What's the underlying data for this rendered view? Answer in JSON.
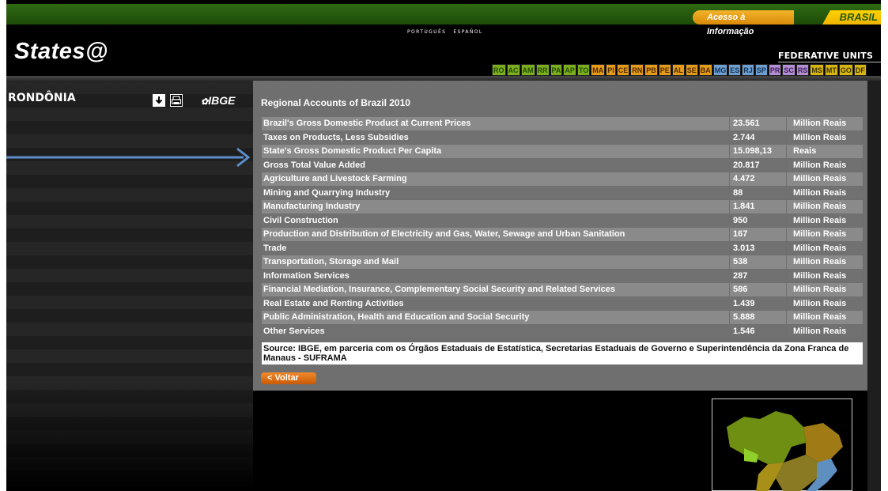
{
  "gov_bar": {
    "acesso": "Acesso à Informação",
    "brasil": "BRASIL"
  },
  "header": {
    "languages": [
      "PORTUGUÊS",
      "ESPAÑOL"
    ],
    "logo": "States@",
    "federative_units": "FEDERATIVE UNITS",
    "states": [
      {
        "code": "RO",
        "color": "g"
      },
      {
        "code": "AC",
        "color": "g"
      },
      {
        "code": "AM",
        "color": "g"
      },
      {
        "code": "RR",
        "color": "g"
      },
      {
        "code": "PA",
        "color": "g"
      },
      {
        "code": "AP",
        "color": "g"
      },
      {
        "code": "TO",
        "color": "g"
      },
      {
        "code": "MA",
        "color": "o"
      },
      {
        "code": "PI",
        "color": "o"
      },
      {
        "code": "CE",
        "color": "o"
      },
      {
        "code": "RN",
        "color": "o"
      },
      {
        "code": "PB",
        "color": "o"
      },
      {
        "code": "PE",
        "color": "o"
      },
      {
        "code": "AL",
        "color": "o"
      },
      {
        "code": "SE",
        "color": "o"
      },
      {
        "code": "BA",
        "color": "o"
      },
      {
        "code": "MG",
        "color": "b"
      },
      {
        "code": "ES",
        "color": "b"
      },
      {
        "code": "RJ",
        "color": "b"
      },
      {
        "code": "SP",
        "color": "b"
      },
      {
        "code": "PR",
        "color": "p"
      },
      {
        "code": "SC",
        "color": "p"
      },
      {
        "code": "RS",
        "color": "p"
      },
      {
        "code": "MS",
        "color": "y"
      },
      {
        "code": "MT",
        "color": "y"
      },
      {
        "code": "GO",
        "color": "y"
      },
      {
        "code": "DF",
        "color": "y"
      }
    ]
  },
  "left_panel": {
    "state_name": "RONDÔNIA",
    "ibge": "IBGE"
  },
  "content": {
    "title": "Regional Accounts of Brazil 2010",
    "rows": [
      {
        "label": "Brazil's Gross Domestic Product at Current Prices",
        "value": "23.561",
        "unit": "Million Reais"
      },
      {
        "label": "Taxes on Products, Less Subsidies",
        "value": "2.744",
        "unit": "Million Reais"
      },
      {
        "label": "State's Gross Domestic Product Per Capita",
        "value": "15.098,13",
        "unit": "Reais"
      },
      {
        "label": "Gross Total Value Added",
        "value": "20.817",
        "unit": "Million Reais"
      },
      {
        "label": "Agriculture and Livestock Farming",
        "value": "4.472",
        "unit": "Million Reais"
      },
      {
        "label": "Mining and Quarrying Industry",
        "value": "88",
        "unit": "Million Reais"
      },
      {
        "label": "Manufacturing Industry",
        "value": "1.841",
        "unit": "Million Reais"
      },
      {
        "label": "Civil Construction",
        "value": "950",
        "unit": "Million Reais"
      },
      {
        "label": "Production and Distribution of Electricity and Gas, Water, Sewage and Urban Sanitation",
        "value": "167",
        "unit": "Million Reais"
      },
      {
        "label": "Trade",
        "value": "3.013",
        "unit": "Million Reais"
      },
      {
        "label": "Transportation, Storage and Mail",
        "value": "538",
        "unit": "Million Reais"
      },
      {
        "label": "Information Services",
        "value": "287",
        "unit": "Million Reais"
      },
      {
        "label": "Financial Mediation, Insurance, Complementary Social Security and Related Services",
        "value": "586",
        "unit": "Million Reais"
      },
      {
        "label": "Real Estate and Renting Activities",
        "value": "1.439",
        "unit": "Million Reais"
      },
      {
        "label": "Public Administration, Health and Education and Social Security",
        "value": "5.888",
        "unit": "Million Reais"
      },
      {
        "label": "Other Services",
        "value": "1.546",
        "unit": "Million Reais"
      }
    ],
    "source": "Source: IBGE, em parceria com os Órgãos Estaduais de Estatística, Secretarias Estaduais de Governo e Superintendência da Zona Franca de Manaus - SUFRAMA",
    "back_button": "< Voltar"
  },
  "icons": [
    "download-icon",
    "print-icon",
    "ibge-logo",
    "brazil-minimap",
    "pointer-arrow"
  ]
}
